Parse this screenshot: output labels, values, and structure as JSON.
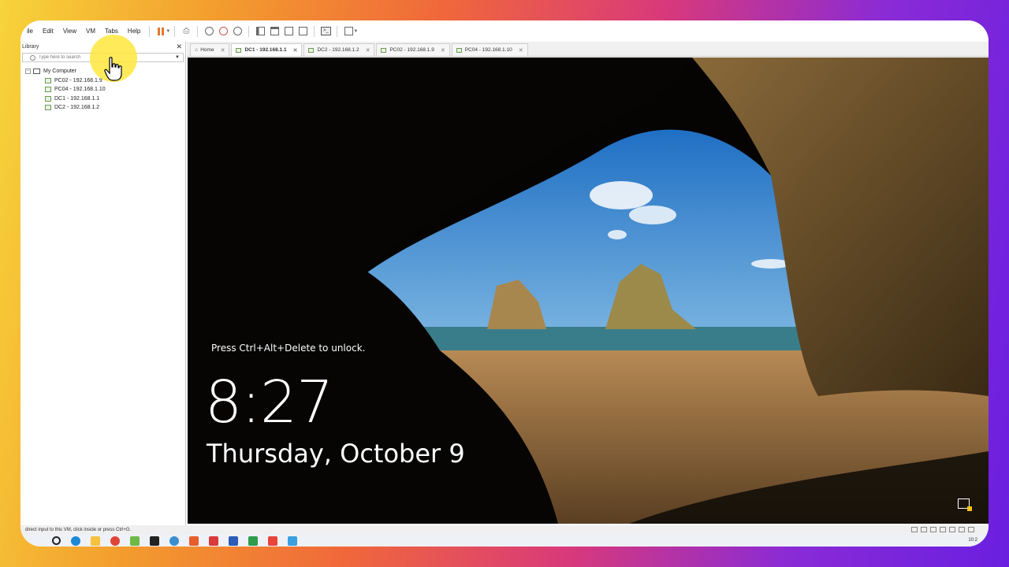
{
  "menu": {
    "items": [
      "ile",
      "Edit",
      "View",
      "VM",
      "Tabs",
      "Help"
    ]
  },
  "library": {
    "title": "Library",
    "close_glyph": "✕",
    "search_placeholder": "Type here to search",
    "tree": {
      "root_label": "My Computer",
      "vms": [
        "PC02 - 192.168.1.9",
        "PC04 - 192.168.1.10",
        "DC1 - 192.168.1.1",
        "DC2 - 192.168.1.2"
      ]
    }
  },
  "tabs": [
    {
      "label": "Home",
      "active": false
    },
    {
      "label": "DC1 - 192.168.1.1",
      "active": true
    },
    {
      "label": "DC2 - 192.168.1.2",
      "active": false
    },
    {
      "label": "PC02 - 192.168.1.9",
      "active": false
    },
    {
      "label": "PC04 - 192.168.1.10",
      "active": false
    }
  ],
  "vm_screen": {
    "unlock_message": "Press Ctrl+Alt+Delete to unlock.",
    "time": "8:27",
    "date": "Thursday, October 9"
  },
  "status_bar": {
    "text": "direct input to this VM, click inside or press Ctrl+G."
  },
  "taskbar": {
    "clock": "10:2"
  },
  "colors": {
    "pause_accent": "#e2772d",
    "frame_gradient": [
      "#f7d43a",
      "#f0683a",
      "#d9397a",
      "#6a1fe0"
    ],
    "cursor_highlight": "#ffe63c"
  }
}
